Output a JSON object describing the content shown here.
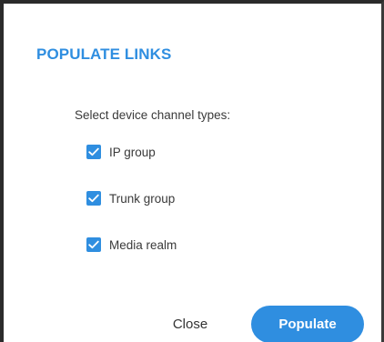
{
  "dialog": {
    "title": "POPULATE LINKS",
    "instruction": "Select device channel types:",
    "options": [
      {
        "label": "IP group",
        "checked": true
      },
      {
        "label": "Trunk group",
        "checked": true
      },
      {
        "label": "Media realm",
        "checked": true
      }
    ],
    "buttons": {
      "close_label": "Close",
      "populate_label": "Populate"
    }
  },
  "colors": {
    "accent": "#2f8ee0",
    "text": "#3a3a3a",
    "border": "#2b2b2b"
  },
  "icons": {
    "checkbox_checked": "checkmark-icon"
  }
}
